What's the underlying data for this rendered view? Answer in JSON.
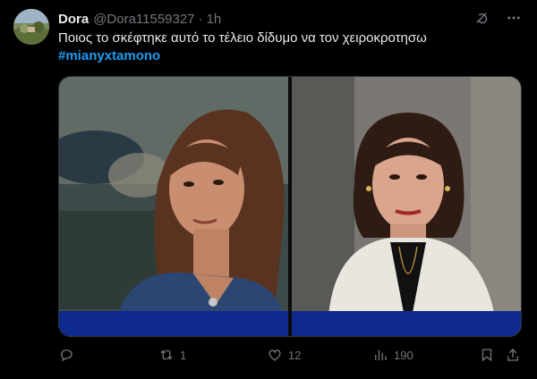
{
  "author": {
    "name": "Dora",
    "handle": "@Dora11559327",
    "separator": "·",
    "time": "1h"
  },
  "tweet": {
    "text": "Ποιος το σκέφτηκε αυτό το τέλειο δίδυμο να τον χειροκροτησω",
    "hashtag": "#mianyxtamono"
  },
  "actions": {
    "replies": "",
    "reposts": "1",
    "likes": "12",
    "views": "190"
  },
  "icons": [
    "grok-icon",
    "more-icon",
    "reply-icon",
    "repost-icon",
    "like-icon",
    "views-icon",
    "bookmark-icon",
    "share-icon"
  ],
  "colors": {
    "background": "#000000",
    "text": "#e7e9ea",
    "muted": "#71767b",
    "link": "#1d9bf0"
  }
}
